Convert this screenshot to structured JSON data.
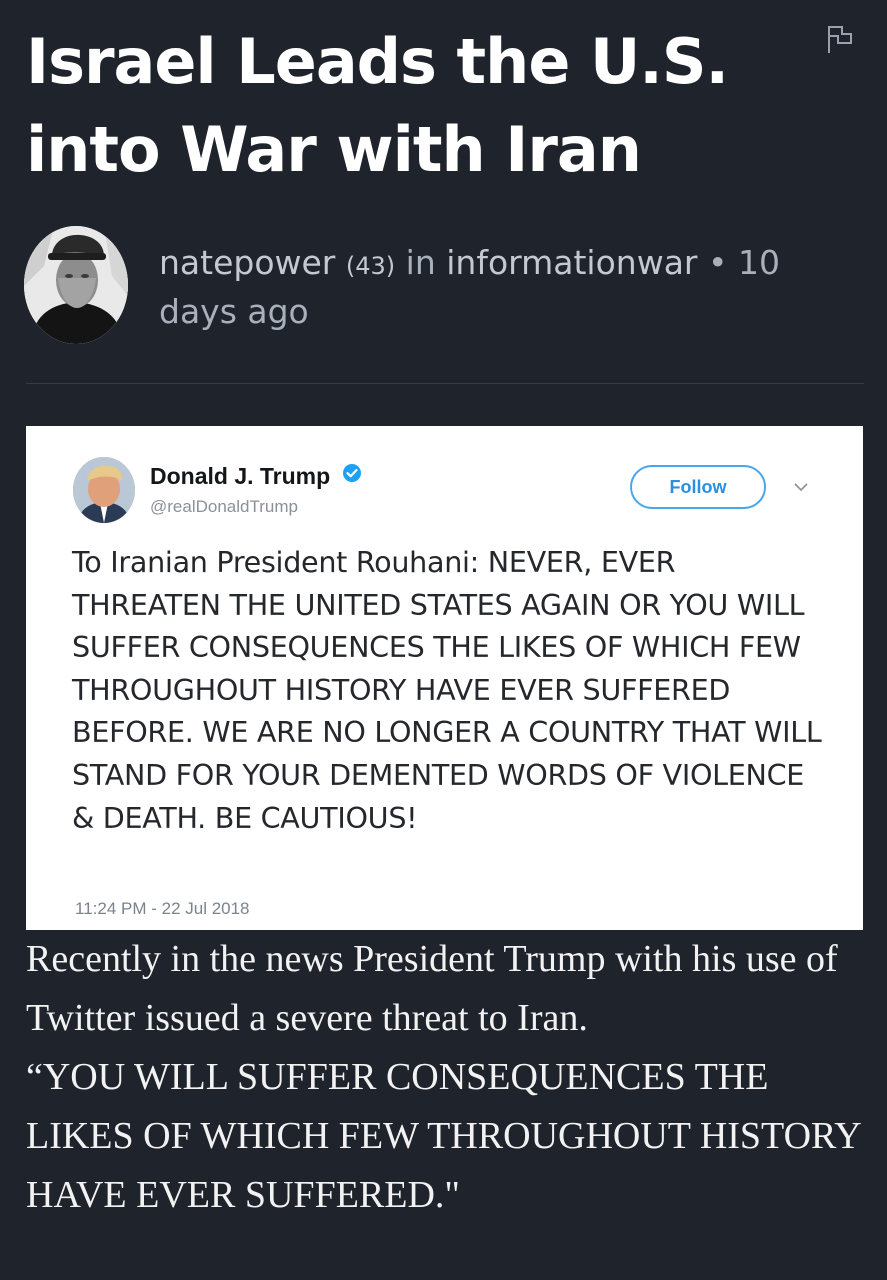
{
  "post": {
    "title": "Israel Leads the U.S. into War with Iran",
    "author": "natepower",
    "reputation": "(43)",
    "in_word": "in",
    "community": "informationwar",
    "separator": "•",
    "time_ago": "10 days ago"
  },
  "tweet": {
    "name": "Donald J. Trump",
    "handle": "@realDonaldTrump",
    "follow_label": "Follow",
    "text": "To Iranian President Rouhani: NEVER, EVER THREATEN THE UNITED STATES AGAIN OR YOU WILL SUFFER CONSEQUENCES THE LIKES OF WHICH FEW THROUGHOUT HISTORY HAVE EVER SUFFERED BEFORE. WE ARE NO LONGER A COUNTRY THAT WILL STAND FOR YOUR DEMENTED WORDS OF VIOLENCE & DEATH. BE CAUTIOUS!",
    "timestamp": "11:24 PM - 22 Jul 2018"
  },
  "body": {
    "paragraph_1": "Recently in the news President Trump with his use of Twitter issued a severe threat to Iran.",
    "paragraph_2": "“YOU WILL SUFFER CONSEQUENCES THE LIKES OF WHICH FEW THROUGHOUT HISTORY HAVE EVER SUFFERED.\""
  },
  "icons": {
    "flag": "flag-icon",
    "verified": "verified-badge-icon",
    "chevron": "chevron-down-icon"
  },
  "colors": {
    "background": "#1f232b",
    "twitter_blue": "#1da1f2"
  }
}
